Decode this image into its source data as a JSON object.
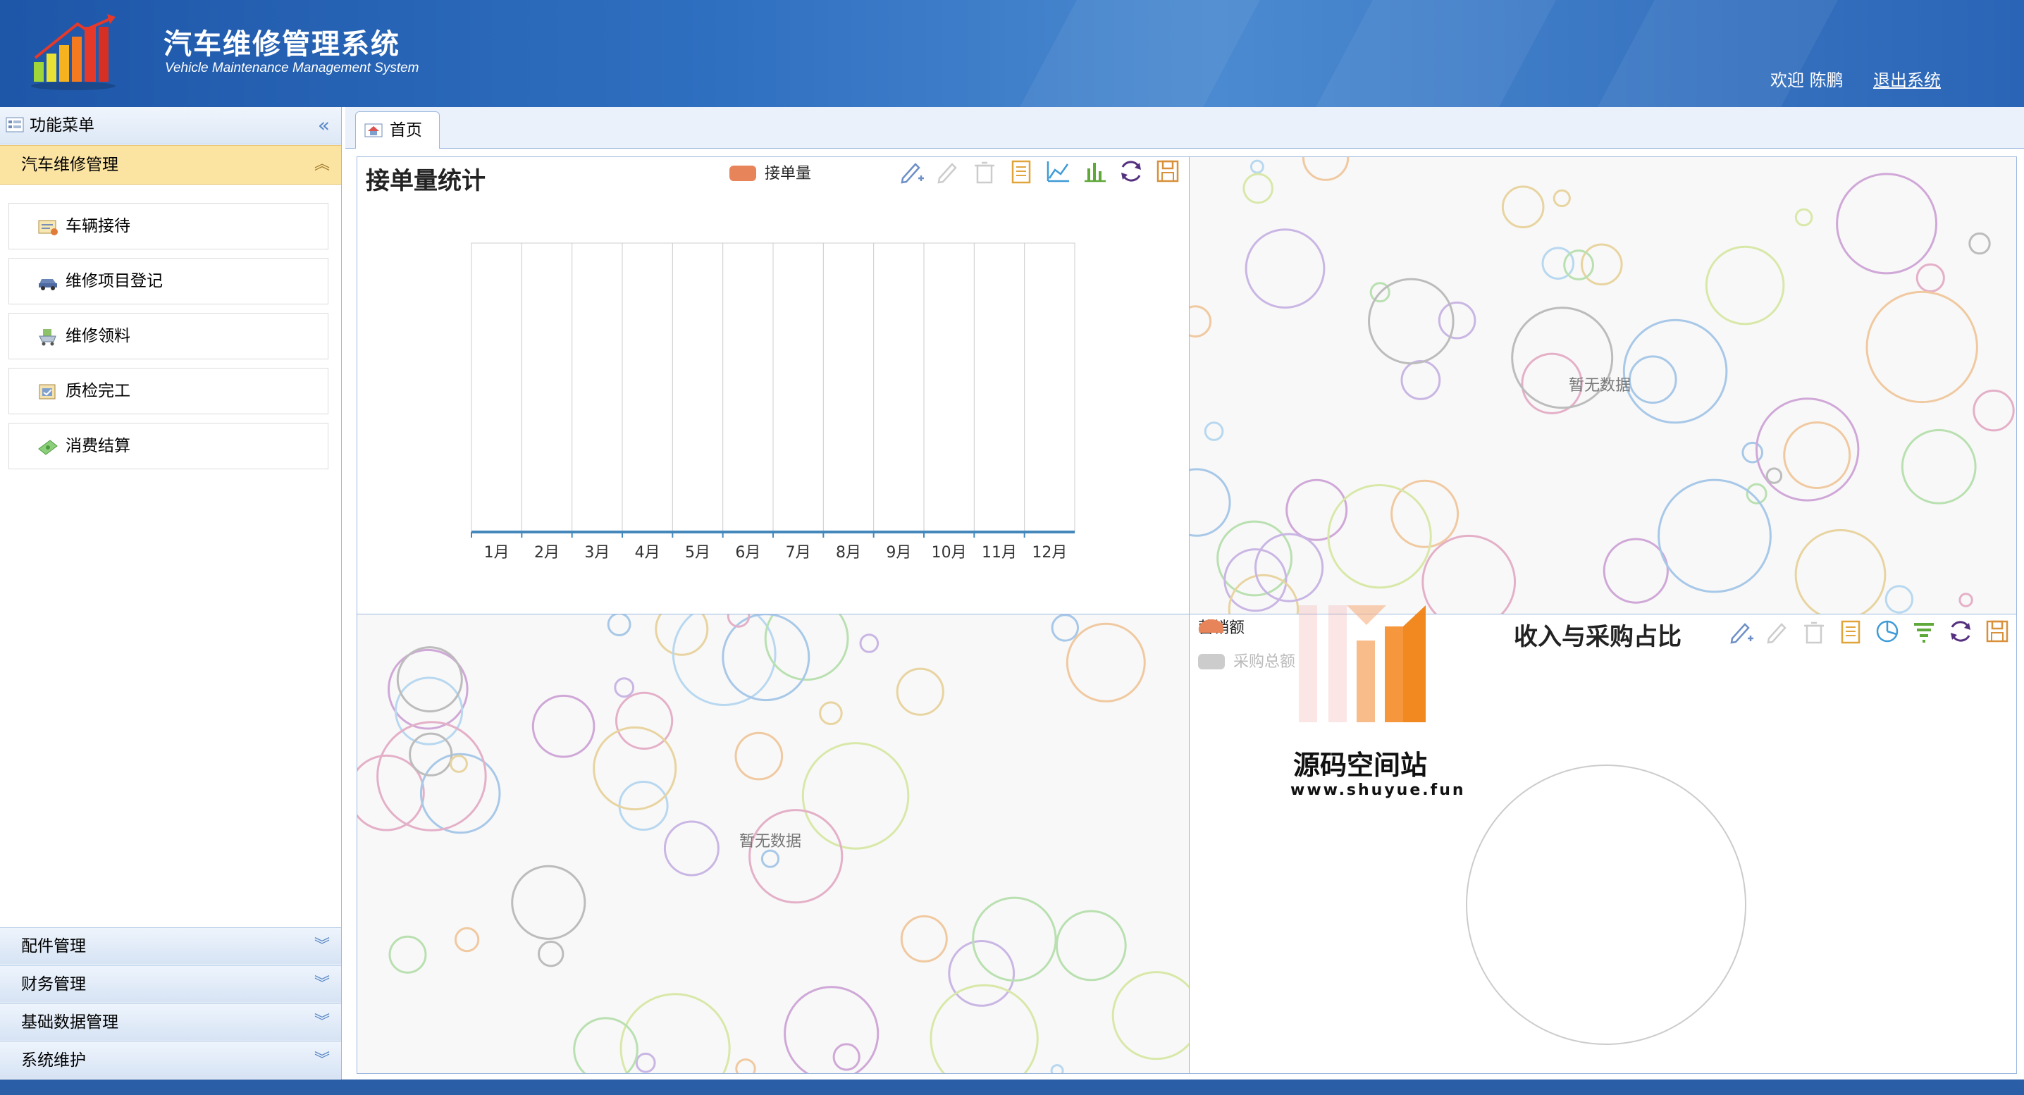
{
  "header": {
    "title_cn": "汽车维修管理系统",
    "title_en": "Vehicle Maintenance Management System",
    "welcome": "欢迎 陈鹏",
    "logout": "退出系统"
  },
  "sidebar": {
    "panel_title": "功能菜单",
    "active_group": "汽车维修管理",
    "items": [
      {
        "label": "车辆接待",
        "icon": "reception-icon"
      },
      {
        "label": "维修项目登记",
        "icon": "car-icon"
      },
      {
        "label": "维修领料",
        "icon": "cart-icon"
      },
      {
        "label": "质检完工",
        "icon": "inspection-icon"
      },
      {
        "label": "消费结算",
        "icon": "money-icon"
      }
    ],
    "groups": [
      "配件管理",
      "财务管理",
      "基础数据管理",
      "系统维护"
    ]
  },
  "tabs": [
    {
      "label": "首页",
      "icon": "home-icon"
    }
  ],
  "panels": {
    "orders": {
      "title": "接单量统计",
      "legend": "接单量",
      "legend_color": "#e8845a"
    },
    "top_right": {
      "empty_text": "暂无数据"
    },
    "bottom_left": {
      "empty_text": "暂无数据"
    },
    "income": {
      "title": "收入与采购占比",
      "legend": [
        {
          "label": "营销额",
          "color": "#e8845a"
        },
        {
          "label": "采购总额",
          "color": "#cccccc"
        }
      ]
    }
  },
  "watermark": {
    "text_cn": "源码空间站",
    "text_url": "www.shuyue.fun"
  },
  "chart_data": [
    {
      "type": "bar",
      "title": "接单量统计",
      "categories": [
        "1月",
        "2月",
        "3月",
        "4月",
        "5月",
        "6月",
        "7月",
        "8月",
        "9月",
        "10月",
        "11月",
        "12月"
      ],
      "series": [
        {
          "name": "接单量",
          "values": [
            0,
            0,
            0,
            0,
            0,
            0,
            0,
            0,
            0,
            0,
            0,
            0
          ]
        }
      ],
      "grid": true,
      "legend": "top-center"
    },
    {
      "type": "pie",
      "title": "收入与采购占比",
      "series": [
        {
          "name": "营销额",
          "values": []
        },
        {
          "name": "采购总额",
          "values": []
        }
      ],
      "legend": "top-left"
    }
  ]
}
